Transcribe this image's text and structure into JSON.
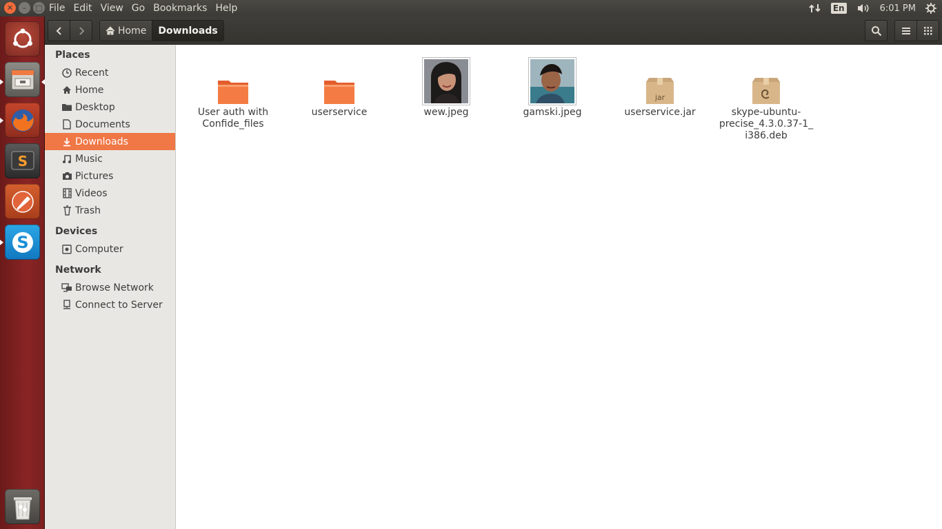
{
  "top_panel": {
    "menu": [
      "File",
      "Edit",
      "View",
      "Go",
      "Bookmarks",
      "Help"
    ],
    "keyboard_layout": "En",
    "clock": "6:01 PM"
  },
  "launcher": {
    "apps": [
      "dash-icon",
      "files-icon",
      "firefox-icon",
      "sublime-text-icon",
      "inkscape-icon",
      "skype-icon",
      "trash-icon"
    ]
  },
  "toolbar": {
    "breadcrumbs": [
      "Home",
      "Downloads"
    ]
  },
  "sidebar": {
    "sections": [
      {
        "title": "Places",
        "items": [
          {
            "label": "Recent",
            "icon": "clock-icon"
          },
          {
            "label": "Home",
            "icon": "home-icon"
          },
          {
            "label": "Desktop",
            "icon": "folder-icon"
          },
          {
            "label": "Documents",
            "icon": "document-icon"
          },
          {
            "label": "Downloads",
            "icon": "download-icon",
            "selected": true
          },
          {
            "label": "Music",
            "icon": "music-icon"
          },
          {
            "label": "Pictures",
            "icon": "camera-icon"
          },
          {
            "label": "Videos",
            "icon": "film-icon"
          },
          {
            "label": "Trash",
            "icon": "trash-icon"
          }
        ]
      },
      {
        "title": "Devices",
        "items": [
          {
            "label": "Computer",
            "icon": "drive-icon"
          }
        ]
      },
      {
        "title": "Network",
        "items": [
          {
            "label": "Browse Network",
            "icon": "network-icon"
          },
          {
            "label": "Connect to Server",
            "icon": "server-icon"
          }
        ]
      }
    ]
  },
  "files": [
    {
      "name_line1": "User auth with",
      "name_line2": "Confide_files",
      "name_line3": "",
      "type": "folder"
    },
    {
      "name_line1": "userservice",
      "name_line2": "",
      "name_line3": "",
      "type": "folder"
    },
    {
      "name_line1": "wew.jpeg",
      "name_line2": "",
      "name_line3": "",
      "type": "image"
    },
    {
      "name_line1": "gamski.jpeg",
      "name_line2": "",
      "name_line3": "",
      "type": "image"
    },
    {
      "name_line1": "userservice.jar",
      "name_line2": "",
      "name_line3": "",
      "type": "jar",
      "badge": "jar"
    },
    {
      "name_line1": "skype-ubuntu-",
      "name_line2": "precise_4.3.0.37-1_",
      "name_line3": "i386.deb",
      "type": "deb"
    }
  ],
  "colors": {
    "accent": "#f07746",
    "panel": "#3c3b37",
    "launcher": "#7a2020"
  }
}
